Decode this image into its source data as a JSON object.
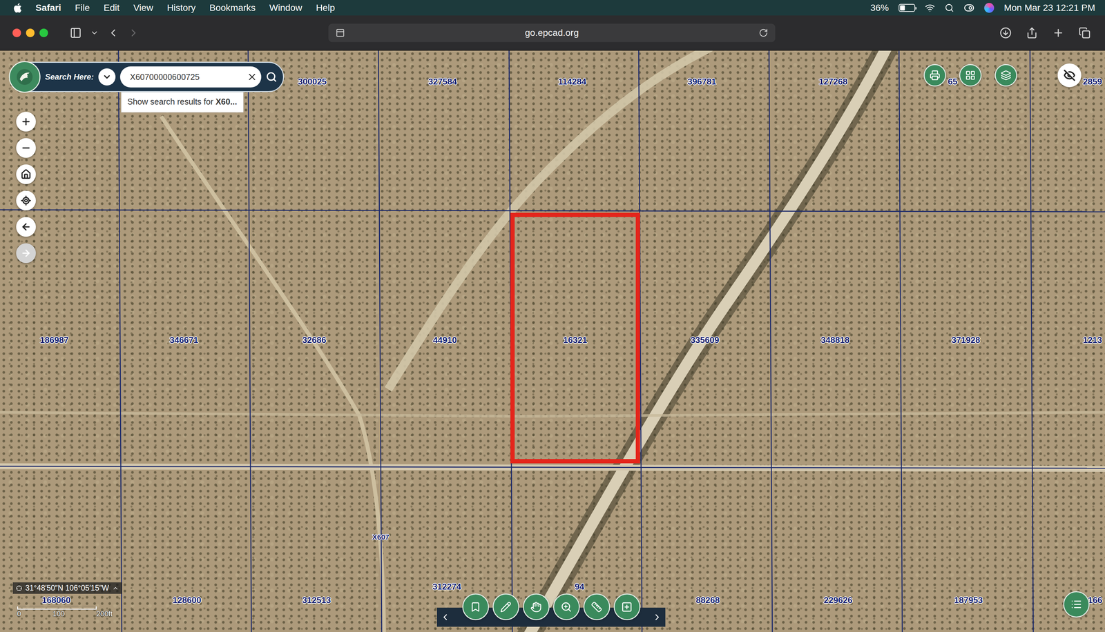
{
  "menu_bar": {
    "app": "Safari",
    "items": [
      "File",
      "Edit",
      "View",
      "History",
      "Bookmarks",
      "Window",
      "Help"
    ],
    "battery": "36%",
    "battery_level": 0.36,
    "clock": "Mon Mar 23 12:21 PM"
  },
  "browser": {
    "address": "go.epcad.org",
    "back": {
      "disabled": false
    },
    "forward": {
      "disabled": true
    }
  },
  "search": {
    "label": "Search Here:",
    "value": "X60700000600725",
    "suggestion": {
      "prefix": "Show search results for ",
      "term": "X60..."
    }
  },
  "map": {
    "parcels": [
      {
        "label": "300025",
        "selected": false
      },
      {
        "label": "327584",
        "selected": false
      },
      {
        "label": "114284",
        "selected": false
      },
      {
        "label": "396781",
        "selected": false
      },
      {
        "label": "127268",
        "selected": false
      },
      {
        "label": "65",
        "selected": false
      },
      {
        "label": "2859",
        "selected": false
      },
      {
        "label": "186987",
        "selected": false
      },
      {
        "label": "346671",
        "selected": false
      },
      {
        "label": "32686",
        "selected": false
      },
      {
        "label": "44910",
        "selected": false
      },
      {
        "label": "16321",
        "selected": true
      },
      {
        "label": "335609",
        "selected": false
      },
      {
        "label": "348818",
        "selected": false
      },
      {
        "label": "371928",
        "selected": false
      },
      {
        "label": "1213",
        "selected": false
      },
      {
        "label": "168060",
        "selected": false
      },
      {
        "label": "128600",
        "selected": false
      },
      {
        "label": "312513",
        "selected": false
      },
      {
        "label": "312274",
        "selected": false
      },
      {
        "label": "94",
        "selected": false
      },
      {
        "label": "88268",
        "selected": false
      },
      {
        "label": "229626",
        "selected": false
      },
      {
        "label": "187953",
        "selected": false
      },
      {
        "label": "166",
        "selected": false
      }
    ],
    "road_labels": [
      "X607"
    ],
    "controls": [
      {
        "kind": "zoom-in",
        "disabled": false
      },
      {
        "kind": "zoom-out",
        "disabled": false
      },
      {
        "kind": "home",
        "disabled": false
      },
      {
        "kind": "locate",
        "disabled": false
      },
      {
        "kind": "back",
        "disabled": false
      },
      {
        "kind": "forward",
        "disabled": true
      }
    ],
    "coordinates": "31°48′50″N 106°05′15″W",
    "scale": [
      "0",
      "100",
      "200ft"
    ]
  }
}
